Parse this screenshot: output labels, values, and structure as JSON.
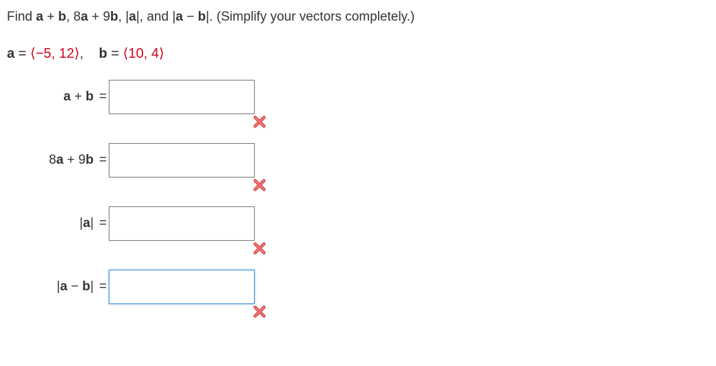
{
  "question": {
    "prefix": "Find ",
    "expr1_a": "a",
    "expr1_plus": " + ",
    "expr1_b": "b",
    "sep1": ", ",
    "expr2_8": "8",
    "expr2_a": "a",
    "expr2_plus": " + ",
    "expr2_9": "9",
    "expr2_b": "b",
    "sep2": ", ",
    "expr3_bar1": "|",
    "expr3_a": "a",
    "expr3_bar2": "|",
    "sep3": ", and ",
    "expr4_bar1": "|",
    "expr4_a": "a",
    "expr4_minus": " − ",
    "expr4_b": "b",
    "expr4_bar2": "|",
    "suffix": ". (Simplify your vectors completely.)"
  },
  "given": {
    "a_label": "a",
    "a_eq": " = ",
    "a_coord": "−5, 12",
    "sep": ",    ",
    "b_label": "b",
    "b_eq": " = ",
    "b_coord": "10, 4"
  },
  "rows": {
    "r1": {
      "part1": "a",
      "part2": " + ",
      "part3": "b",
      "equals": "=",
      "value": ""
    },
    "r2": {
      "part0": "8",
      "part1": "a",
      "part2": " + 9",
      "part3": "b",
      "equals": "=",
      "value": ""
    },
    "r3": {
      "part0": "|",
      "part1": "a",
      "part2": "|",
      "equals": "=",
      "value": ""
    },
    "r4": {
      "part0": "|",
      "part1": "a",
      "part2": " − ",
      "part3": "b",
      "part4": "|",
      "equals": "=",
      "value": ""
    }
  }
}
